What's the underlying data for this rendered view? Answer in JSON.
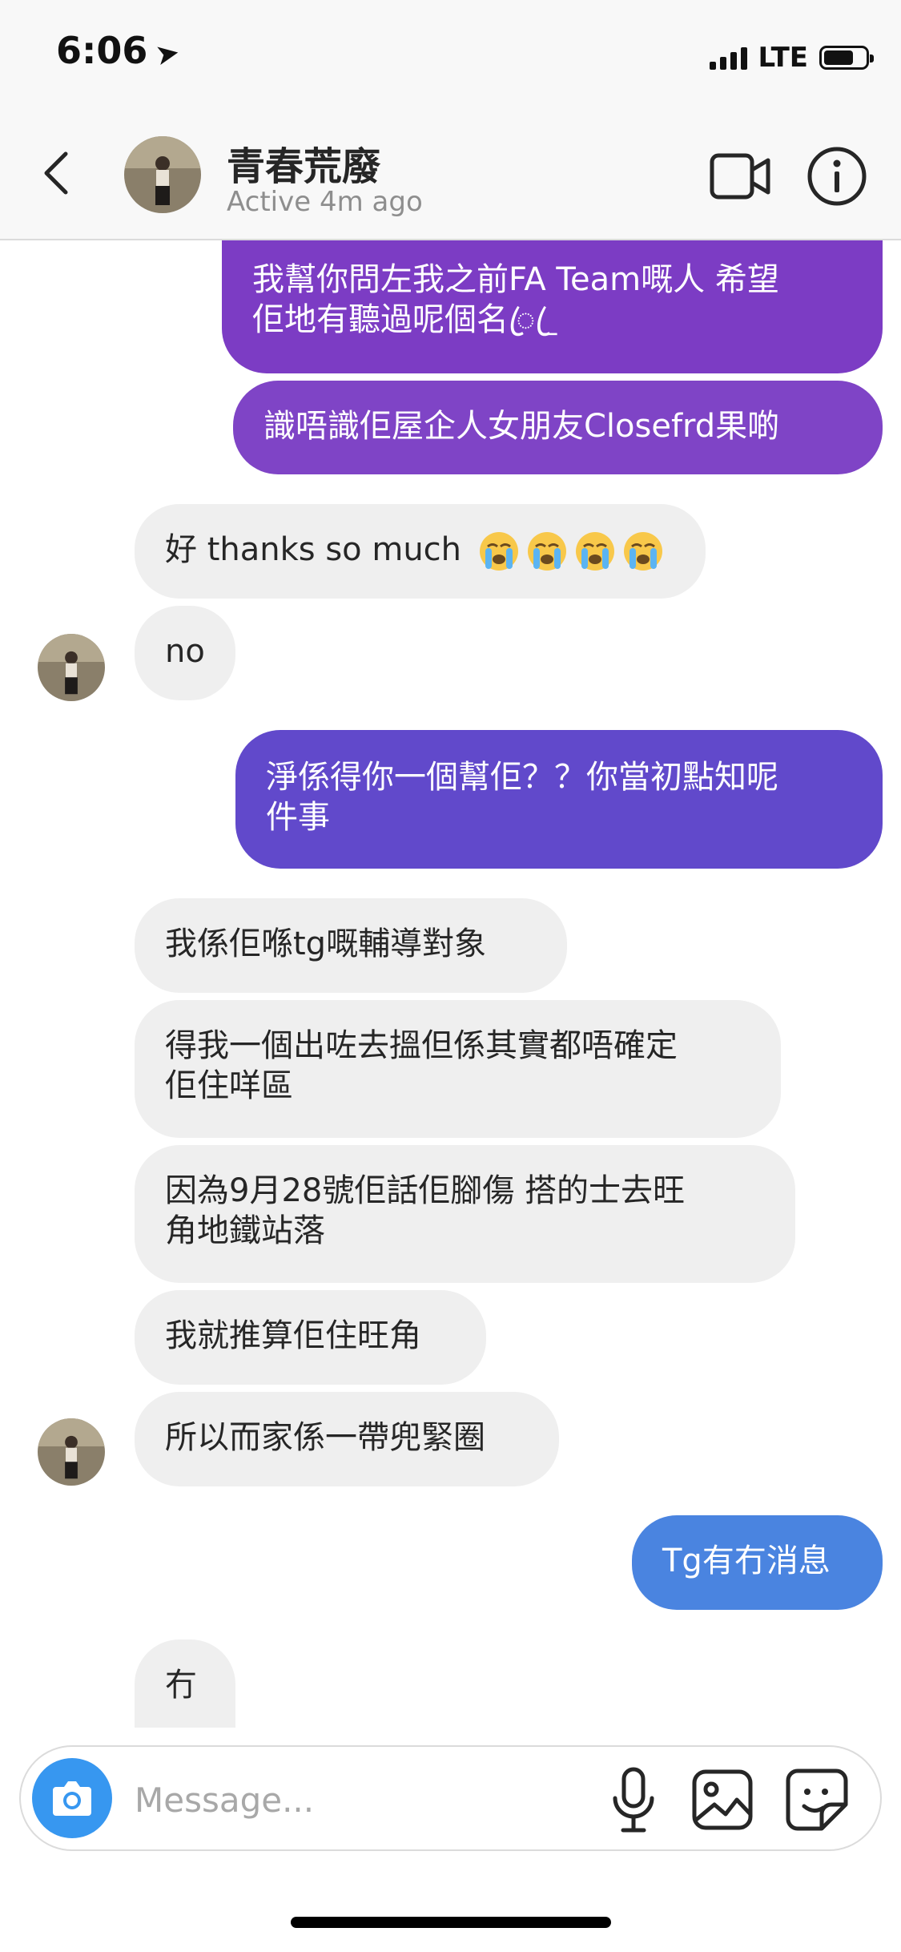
{
  "status_bar": {
    "time": "6:06",
    "network": "LTE",
    "battery_percent": 72,
    "signal_bars": 4
  },
  "header": {
    "title": "青春荒廢",
    "status": "Active 4m ago",
    "icons": [
      "chevron-left-icon",
      "video-camera-icon",
      "info-icon"
    ]
  },
  "messages": [
    {
      "from": "me",
      "lines": [
        "我幫你問左我之前FA Team嘅人 希望",
        "佢地有聽過呢個名ꦿ_ꦿ"
      ]
    },
    {
      "from": "me",
      "lines": [
        "識唔識佢屋企人女朋友Closefrd果啲"
      ]
    },
    {
      "from": "them",
      "lines": [
        "好 thanks so much"
      ],
      "emoji_count": 4,
      "emoji": "loudly-crying-face"
    },
    {
      "from": "them",
      "lines": [
        "no"
      ]
    },
    {
      "from": "me",
      "lines": [
        "淨係得你一個幫佢？？你當初點知呢",
        "件事"
      ]
    },
    {
      "from": "them",
      "lines": [
        "我係佢喺tg嘅輔導對象"
      ]
    },
    {
      "from": "them",
      "lines": [
        "得我一個出咗去搵但係其實都唔確定",
        "佢住咩區"
      ]
    },
    {
      "from": "them",
      "lines": [
        "因為9月28號佢話佢腳傷 搭的士去旺",
        "角地鐵站落"
      ]
    },
    {
      "from": "them",
      "lines": [
        "我就推算佢住旺角"
      ]
    },
    {
      "from": "them",
      "lines": [
        "所以而家係一帶兜緊圈"
      ]
    },
    {
      "from": "me",
      "lines": [
        "Tg有冇消息"
      ]
    },
    {
      "from": "them",
      "lines": [
        "冇"
      ]
    }
  ],
  "composer": {
    "placeholder": "Message..."
  },
  "colors": {
    "accent_blue": "#3797f0",
    "bubble_purple": "#7c3cc4",
    "bubble_indigo": "#6149cb",
    "bubble_blue": "#4a84e0",
    "bubble_gray": "#efefef"
  }
}
